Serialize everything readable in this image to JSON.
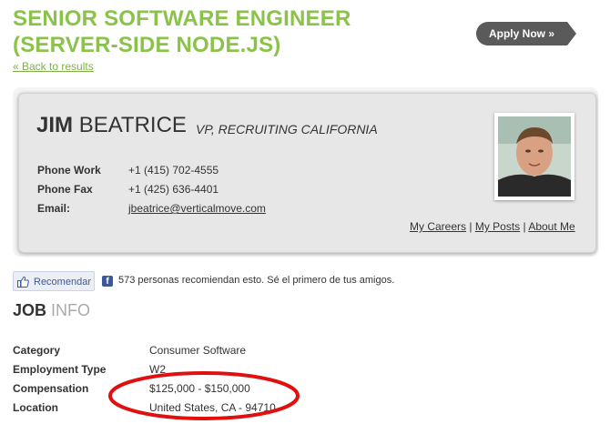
{
  "job": {
    "title_line1": "Senior Software Engineer",
    "title_line2": "(Server-Side Node.js)",
    "back_link": "« Back to results",
    "apply_label": "Apply Now »"
  },
  "recruiter": {
    "first_name": "Jim",
    "last_name": "Beatrice",
    "role": "VP, Recruiting California",
    "contacts": [
      {
        "label": "Phone Work",
        "value": "+1 (415) 702-4555"
      },
      {
        "label": "Phone Fax",
        "value": "+1 (425) 636-4401"
      },
      {
        "label": "Email:",
        "value": "jbeatrice@verticalmove.com"
      }
    ],
    "links": {
      "careers": "My Careers",
      "posts": "My Posts",
      "about": "About Me",
      "separator": "|"
    }
  },
  "social": {
    "recommend_label": "Recomendar",
    "fb_letter": "f",
    "recommend_text": "573 personas recomiendan esto. Sé el primero de tus amigos."
  },
  "info": {
    "title_strong": "Job",
    "title_light": "Info",
    "rows": [
      {
        "label": "Category",
        "value": "Consumer Software"
      },
      {
        "label": "Employment Type",
        "value": "W2"
      },
      {
        "label": "Compensation",
        "value": "$125,000 - $150,000"
      },
      {
        "label": "Location",
        "value": "United States, CA - 94710"
      }
    ]
  },
  "colors": {
    "title_green": "#8bc34a",
    "apply_bg": "#5a5a5a",
    "highlight_red": "#e01010",
    "facebook_blue": "#3b5998"
  }
}
